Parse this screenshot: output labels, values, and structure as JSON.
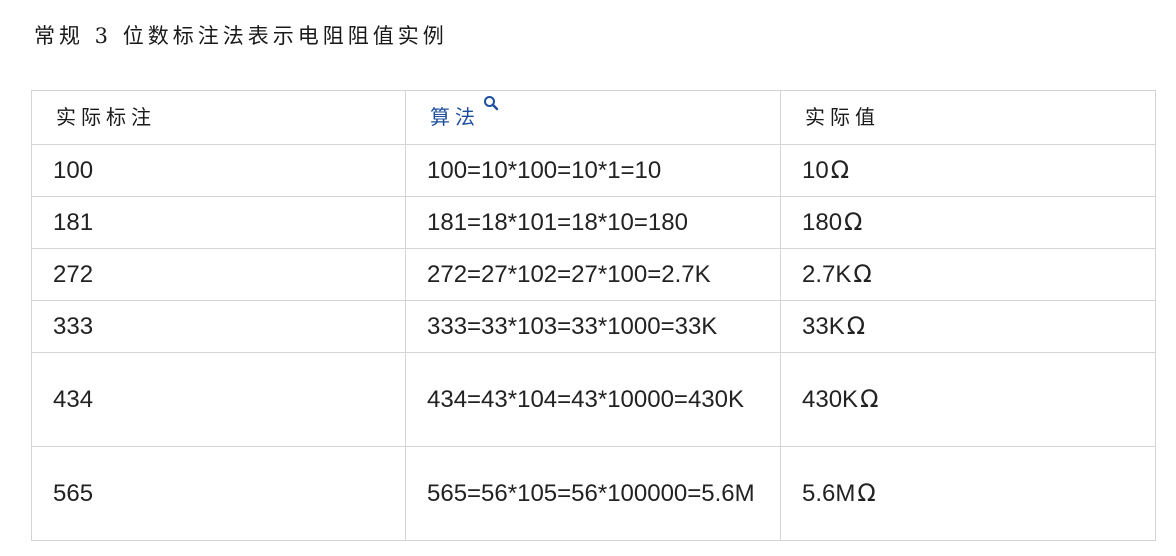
{
  "title": "常规 3 位数标注法表示电阻阻值实例",
  "table": {
    "headers": [
      "实际标注",
      "算法",
      "实际值"
    ],
    "ohm_symbol": "Ω",
    "link_color": "#1e4f9c",
    "rows": [
      {
        "mark": "100",
        "calc": "100=10*100=10*1=10",
        "value": "10"
      },
      {
        "mark": "181",
        "calc": "181=18*101=18*10=180",
        "value": "180"
      },
      {
        "mark": "272",
        "calc": "272=27*102=27*100=2.7K",
        "value": "2.7K"
      },
      {
        "mark": "333",
        "calc": "333=33*103=33*1000=33K",
        "value": "33K"
      },
      {
        "mark": "434",
        "calc": "434=43*104=43*10000=430K",
        "value": "430K"
      },
      {
        "mark": "565",
        "calc": "565=56*105=56*100000=5.6M",
        "value": "5.6M"
      }
    ]
  }
}
